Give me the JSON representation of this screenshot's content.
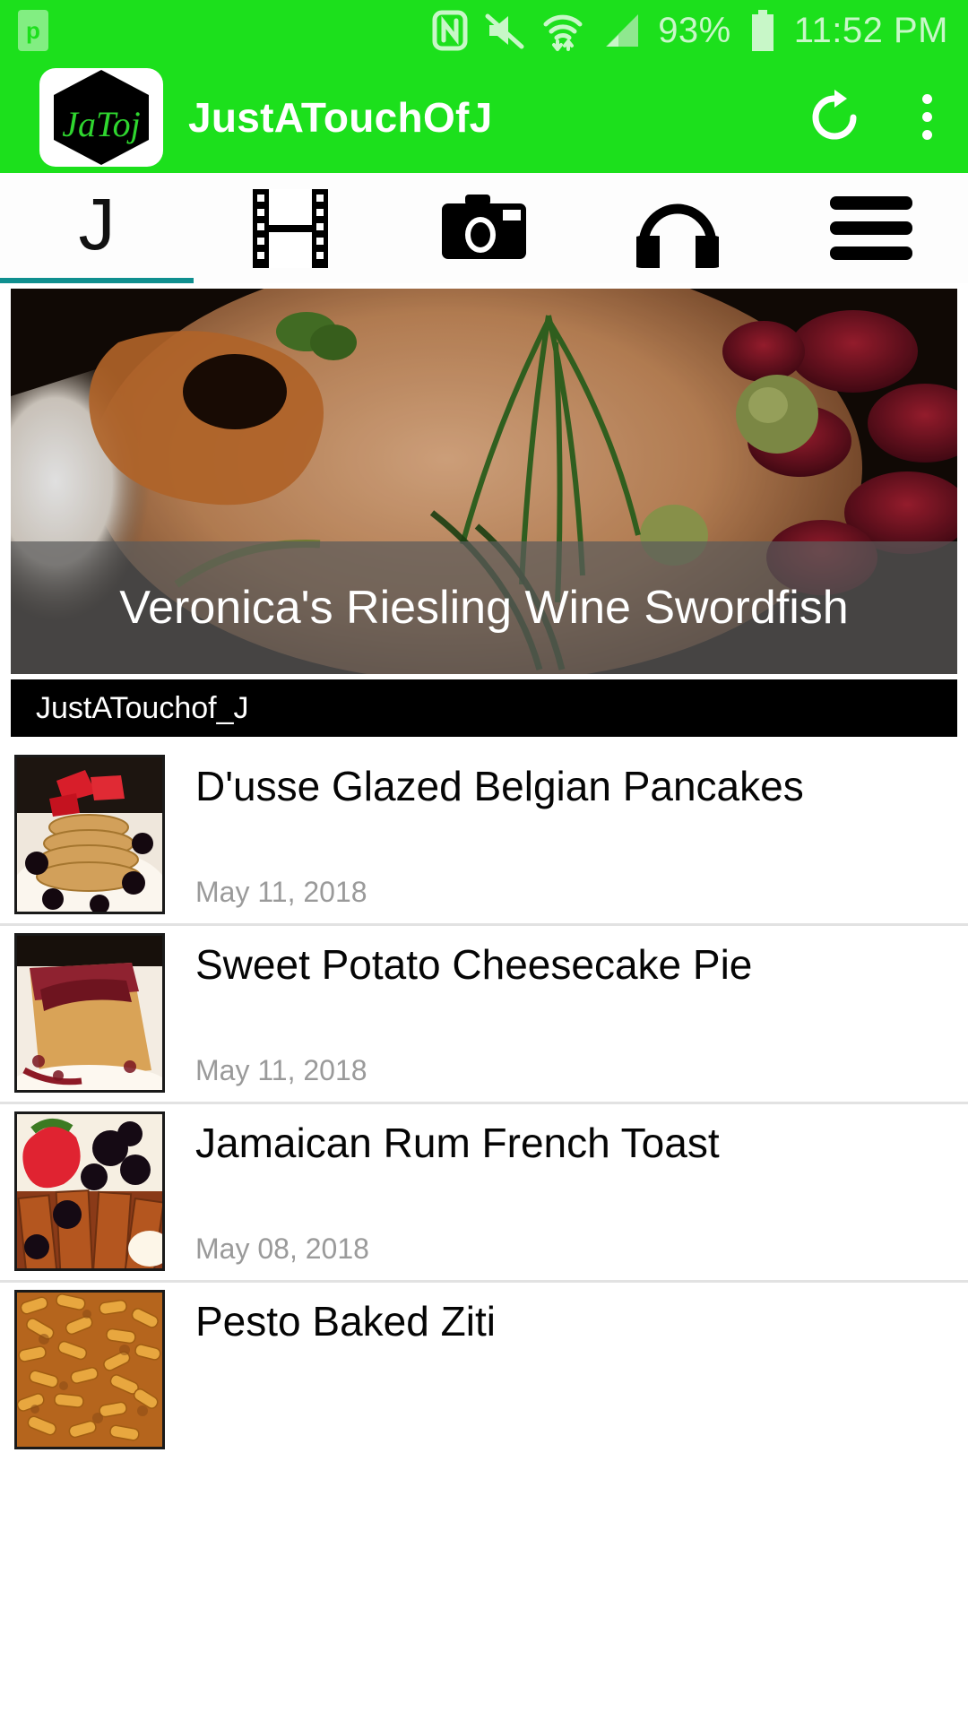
{
  "status_bar": {
    "left_app_badge": "p",
    "icons": [
      "nfc-icon",
      "volume-mute-icon",
      "wifi-icon",
      "cellular-signal-icon"
    ],
    "battery_percent": "93%",
    "time": "11:52 PM",
    "background_color": "#1ce01c",
    "foreground_color": "#c8f7c8"
  },
  "app_bar": {
    "title": "JustATouchOfJ",
    "logo_text": "JaToj",
    "refresh_label": "refresh-icon",
    "overflow_label": "more-options-icon",
    "background_color": "#1ce01c"
  },
  "tabs": {
    "active_index": 0,
    "indicator_color": "#0f8f8f",
    "items": [
      {
        "icon": "letter-j-icon",
        "glyph": "J",
        "label": "Home"
      },
      {
        "icon": "film-strip-icon",
        "glyph": "",
        "label": "Videos"
      },
      {
        "icon": "camera-icon",
        "glyph": "",
        "label": "Photos"
      },
      {
        "icon": "headphones-icon",
        "glyph": "",
        "label": "Audio"
      },
      {
        "icon": "hamburger-menu-icon",
        "glyph": "",
        "label": "Menu"
      }
    ]
  },
  "hero": {
    "title": "Veronica's Riesling Wine Swordfish",
    "overlay_color": "rgba(92,92,92,.72)"
  },
  "author_bar": {
    "name": "JustATouchof_J",
    "background_color": "#000000"
  },
  "posts": [
    {
      "title": "D'usse Glazed Belgian Pancakes",
      "date": "May 11, 2018",
      "thumb": "pancakes-strawberries"
    },
    {
      "title": "Sweet Potato Cheesecake Pie",
      "date": "May 11, 2018",
      "thumb": "cheesecake-slice"
    },
    {
      "title": "Jamaican Rum French Toast",
      "date": "May 08, 2018",
      "thumb": "french-toast-berries"
    },
    {
      "title": "Pesto Baked Ziti",
      "date": "",
      "thumb": "baked-ziti"
    }
  ]
}
